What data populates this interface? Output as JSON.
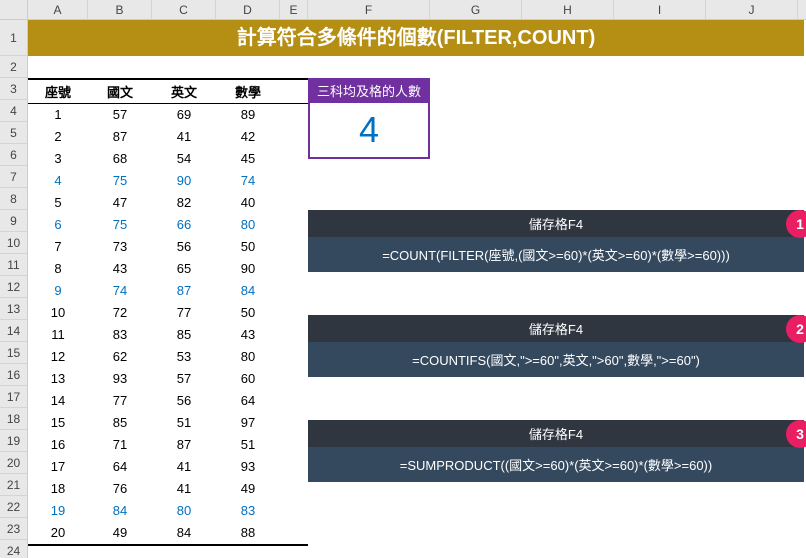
{
  "columns": [
    "A",
    "B",
    "C",
    "D",
    "E",
    "F",
    "G",
    "H",
    "I",
    "J"
  ],
  "row_count": 24,
  "title": "計算符合多條件的個數(FILTER,COUNT)",
  "table": {
    "headers": [
      "座號",
      "國文",
      "英文",
      "數學"
    ],
    "rows": [
      {
        "seat": "1",
        "ch": "57",
        "en": "69",
        "ma": "89",
        "pass": false
      },
      {
        "seat": "2",
        "ch": "87",
        "en": "41",
        "ma": "42",
        "pass": false
      },
      {
        "seat": "3",
        "ch": "68",
        "en": "54",
        "ma": "45",
        "pass": false
      },
      {
        "seat": "4",
        "ch": "75",
        "en": "90",
        "ma": "74",
        "pass": true
      },
      {
        "seat": "5",
        "ch": "47",
        "en": "82",
        "ma": "40",
        "pass": false
      },
      {
        "seat": "6",
        "ch": "75",
        "en": "66",
        "ma": "80",
        "pass": true
      },
      {
        "seat": "7",
        "ch": "73",
        "en": "56",
        "ma": "50",
        "pass": false
      },
      {
        "seat": "8",
        "ch": "43",
        "en": "65",
        "ma": "90",
        "pass": false
      },
      {
        "seat": "9",
        "ch": "74",
        "en": "87",
        "ma": "84",
        "pass": true
      },
      {
        "seat": "10",
        "ch": "72",
        "en": "77",
        "ma": "50",
        "pass": false
      },
      {
        "seat": "11",
        "ch": "83",
        "en": "85",
        "ma": "43",
        "pass": false
      },
      {
        "seat": "12",
        "ch": "62",
        "en": "53",
        "ma": "80",
        "pass": false
      },
      {
        "seat": "13",
        "ch": "93",
        "en": "57",
        "ma": "60",
        "pass": false
      },
      {
        "seat": "14",
        "ch": "77",
        "en": "56",
        "ma": "64",
        "pass": false
      },
      {
        "seat": "15",
        "ch": "85",
        "en": "51",
        "ma": "97",
        "pass": false
      },
      {
        "seat": "16",
        "ch": "71",
        "en": "87",
        "ma": "51",
        "pass": false
      },
      {
        "seat": "17",
        "ch": "64",
        "en": "41",
        "ma": "93",
        "pass": false
      },
      {
        "seat": "18",
        "ch": "76",
        "en": "41",
        "ma": "49",
        "pass": false
      },
      {
        "seat": "19",
        "ch": "84",
        "en": "80",
        "ma": "83",
        "pass": true
      },
      {
        "seat": "20",
        "ch": "49",
        "en": "84",
        "ma": "88",
        "pass": false
      }
    ]
  },
  "result": {
    "label": "三科均及格的人數",
    "value": "4"
  },
  "formulas": [
    {
      "badge": "1",
      "cell": "儲存格F4",
      "text": "=COUNT(FILTER(座號,(國文>=60)*(英文>=60)*(數學>=60)))"
    },
    {
      "badge": "2",
      "cell": "儲存格F4",
      "text": "=COUNTIFS(國文,\">=60\",英文,\">60\",數學,\">=60\")"
    },
    {
      "badge": "3",
      "cell": "儲存格F4",
      "text": "=SUMPRODUCT((國文>=60)*(英文>=60)*(數學>=60))"
    }
  ]
}
